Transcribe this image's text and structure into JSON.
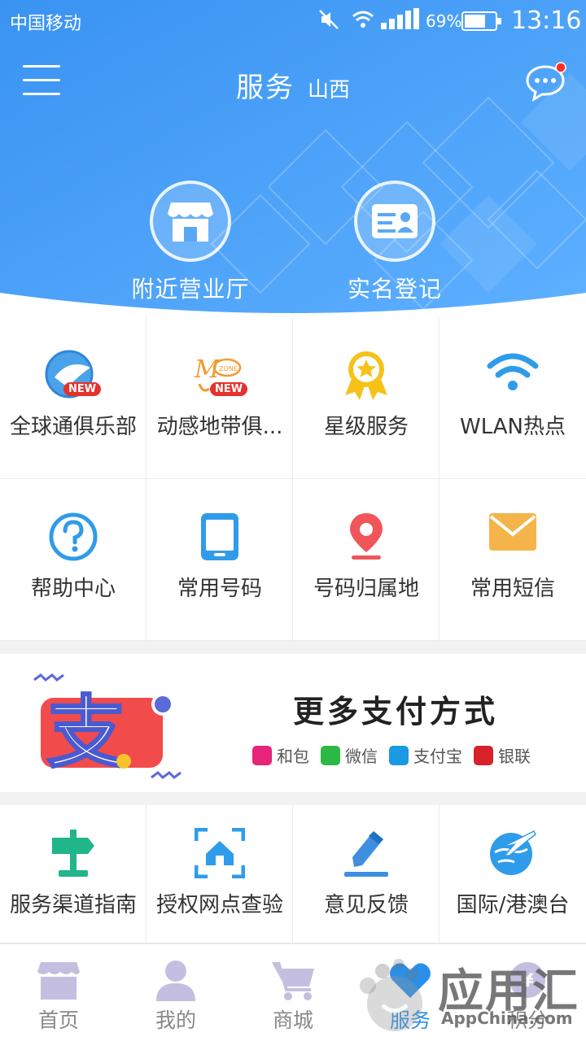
{
  "status_bar": {
    "carrier": "中国移动",
    "battery_percent": "69%",
    "time": "13:16",
    "battery_level": 0.69
  },
  "header": {
    "title": "服务",
    "region": "山西",
    "has_unread_message": true
  },
  "quick_actions": [
    {
      "label": "附近营业厅",
      "icon": "store-icon"
    },
    {
      "label": "实名登记",
      "icon": "id-card-icon"
    }
  ],
  "services_grid": [
    {
      "label": "全球通俱乐部",
      "icon": "globe-club-icon",
      "badge": "NEW"
    },
    {
      "label": "动感地带俱...",
      "icon": "mzone-icon",
      "badge": "NEW"
    },
    {
      "label": "星级服务",
      "icon": "star-medal-icon"
    },
    {
      "label": "WLAN热点",
      "icon": "wifi-icon"
    },
    {
      "label": "帮助中心",
      "icon": "help-icon"
    },
    {
      "label": "常用号码",
      "icon": "phone-icon"
    },
    {
      "label": "号码归属地",
      "icon": "location-pin-icon"
    },
    {
      "label": "常用短信",
      "icon": "envelope-icon"
    }
  ],
  "pay_banner": {
    "title": "更多支付方式",
    "methods": [
      {
        "label": "和包",
        "icon": "hebao-icon",
        "color": "#e6247a"
      },
      {
        "label": "微信",
        "icon": "wechat-icon",
        "color": "#2bb944"
      },
      {
        "label": "支付宝",
        "icon": "alipay-icon",
        "color": "#1a9ae0"
      },
      {
        "label": "银联",
        "icon": "unionpay-icon",
        "color": "#d8222a"
      }
    ]
  },
  "services_grid_2": [
    {
      "label": "服务渠道指南",
      "icon": "signpost-icon"
    },
    {
      "label": "授权网点查验",
      "icon": "home-scan-icon"
    },
    {
      "label": "意见反馈",
      "icon": "pencil-icon"
    },
    {
      "label": "国际/港澳台",
      "icon": "plane-globe-icon"
    }
  ],
  "bottom_nav": [
    {
      "label": "首页",
      "icon": "home-icon"
    },
    {
      "label": "我的",
      "icon": "user-icon"
    },
    {
      "label": "商城",
      "icon": "cart-icon"
    },
    {
      "label": "服务",
      "icon": "service-heart-icon",
      "active": true
    },
    {
      "label": "积分",
      "icon": "points-icon"
    }
  ],
  "watermark": {
    "text": "应用汇",
    "sub": "AppChina.com"
  },
  "colors": {
    "primary_blue": "#2a8fe8",
    "hero_top": "#3c9af5",
    "hero_bottom": "#6ab8ff"
  }
}
